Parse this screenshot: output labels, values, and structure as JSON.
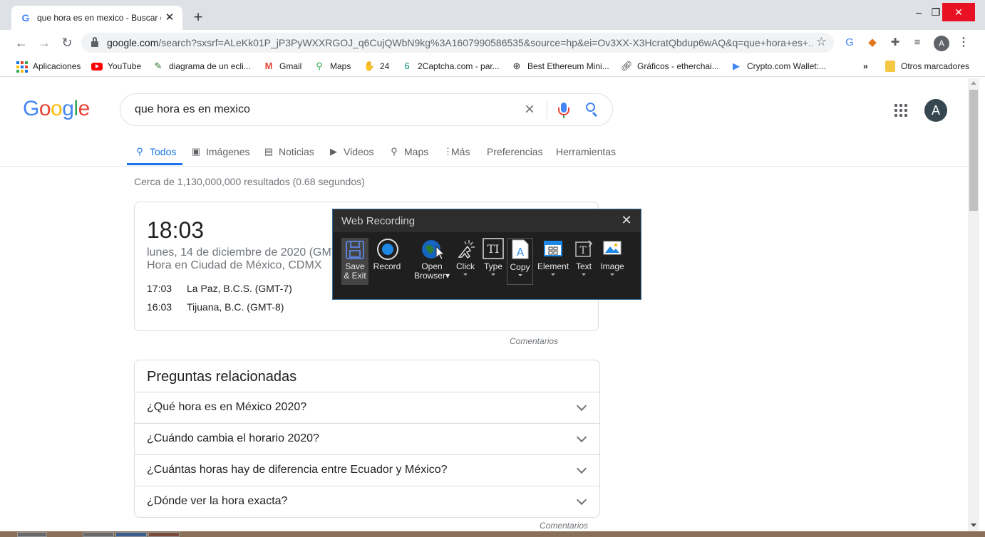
{
  "browser": {
    "tab_title": "que hora es en mexico - Buscar c",
    "tab_favicon": "G",
    "new_tab_label": "+",
    "url_host": "google.com",
    "url_rest": "/search?sxsrf=ALeKk01P_jP3PyWXXRGOJ_q6CujQWbN9kg%3A1607990586535&source=hp&ei=Ov3XX-X3HcratQbdup6wAQ&q=que+hora+es+...",
    "profile_initial": "A"
  },
  "bookmarks": {
    "apps": "Aplicaciones",
    "items": [
      "YouTube",
      "diagrama de un ecli...",
      "Gmail",
      "Maps",
      "24",
      "2Captcha.com - par...",
      "Best Ethereum Mini...",
      "Gráficos - etherchai...",
      "Crypto.com Wallet:..."
    ],
    "overflow": "»",
    "other": "Otros marcadores"
  },
  "search": {
    "query": "que hora es en mexico",
    "avatar_initial": "A",
    "tabs": [
      "Todos",
      "Imágenes",
      "Noticias",
      "Videos",
      "Maps",
      "Más",
      "Preferencias",
      "Herramientas"
    ],
    "result_stats": "Cerca de 1,130,000,000 resultados (0.68 segundos)"
  },
  "time_card": {
    "time": "18:03",
    "date": "lunes, 14 de diciembre de 2020 (GMT",
    "place": "Hora en Ciudad de México, CDMX",
    "rows": [
      {
        "time": "17:03",
        "place": "La Paz, B.C.S. (GMT-7)"
      },
      {
        "time": "16:03",
        "place": "Tijuana, B.C. (GMT-8)"
      }
    ],
    "feedback": "Comentarios"
  },
  "related": {
    "title": "Preguntas relacionadas",
    "questions": [
      "¿Qué hora es en México 2020?",
      "¿Cuándo cambia el horario 2020?",
      "¿Cuántas horas hay de diferencia entre Ecuador y México?",
      "¿Dónde ver la hora exacta?"
    ],
    "feedback": "Comentarios"
  },
  "recorder": {
    "title": "Web Recording",
    "tools": {
      "save_line1": "Save",
      "save_line2": "& Exit",
      "record": "Record",
      "open_line1": "Open",
      "open_line2": "Browser",
      "click": "Click",
      "type": "Type",
      "copy": "Copy",
      "element": "Element",
      "text": "Text",
      "image": "Image"
    }
  },
  "colors": {
    "accent": "#1a73e8",
    "recorder_bg": "#1f1f1f"
  }
}
